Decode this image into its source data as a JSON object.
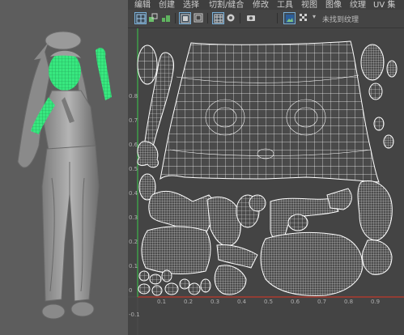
{
  "menu": {
    "items": [
      "编辑",
      "创建",
      "选择",
      "切割/缝合",
      "修改",
      "工具",
      "视图",
      "图像",
      "纹理",
      "UV 集"
    ]
  },
  "toolbar": {
    "texture_dropdown": "未找到纹理"
  },
  "axis": {
    "left_ticks": [
      "0.8",
      "0.7",
      "0.6",
      "0.5",
      "0.4",
      "0.3",
      "0.2",
      "0.1",
      "0",
      "-0.1"
    ],
    "bottom_ticks": [
      "0.1",
      "0.2",
      "0.3",
      "0.4",
      "0.5",
      "0.6",
      "0.7",
      "0.8",
      "0.9"
    ]
  },
  "colors": {
    "selection": "#38e87f",
    "uv_wire": "#ffffff",
    "uv_bg": "#444444",
    "axis_u": "#c0392b",
    "axis_v": "#3cb44b"
  }
}
